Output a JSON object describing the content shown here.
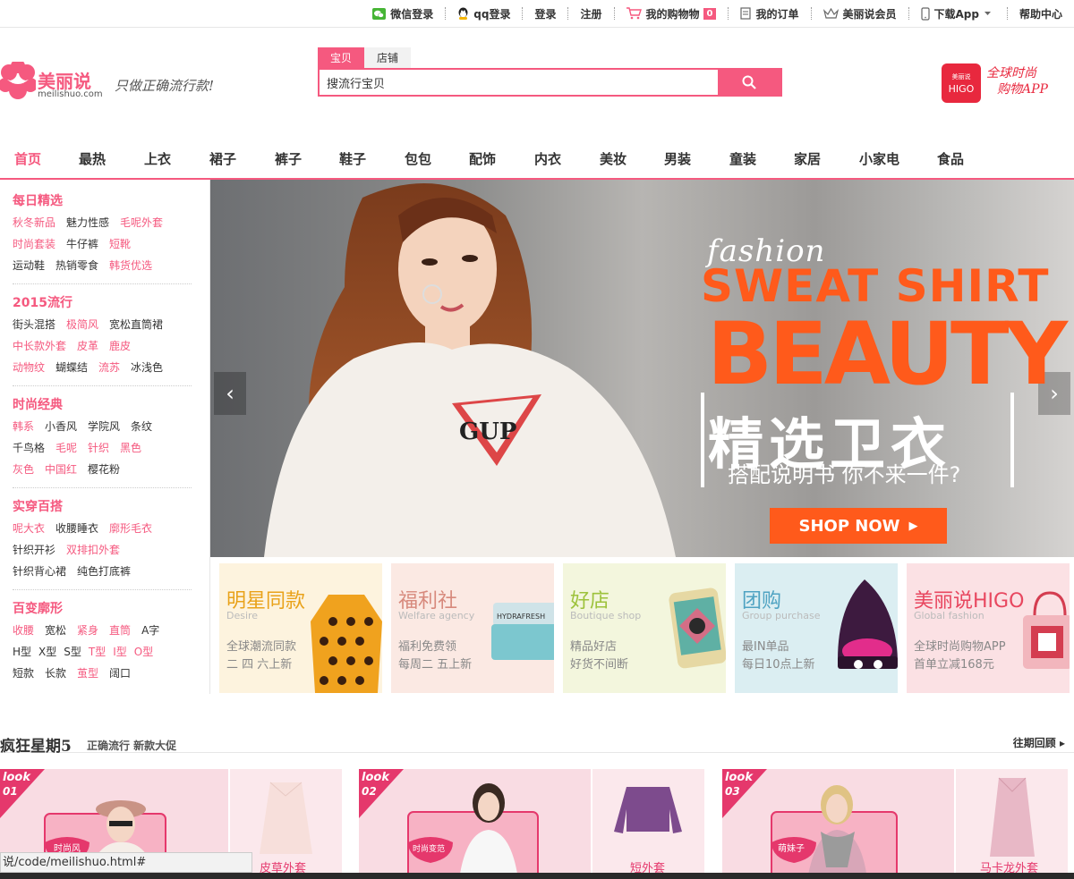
{
  "topbar": {
    "wechat_login": "微信登录",
    "qq_login": "qq登录",
    "login": "登录",
    "register": "注册",
    "cart_label": "我的购物物",
    "cart_count": "0",
    "orders": "我的订单",
    "vip": "美丽说会员",
    "download_app": "下载App",
    "help": "帮助中心"
  },
  "logo": {
    "name": "美丽说",
    "url": "meilishuo.com",
    "slogan": "只做正确流行款!"
  },
  "search": {
    "tabs": [
      "宝贝",
      "店铺"
    ],
    "value": "搜流行宝贝"
  },
  "higo": {
    "brand_top": "美丽说",
    "brand": "HIGO",
    "line1": "全球时尚",
    "line2": "购物APP"
  },
  "nav": [
    "首页",
    "最热",
    "上衣",
    "裙子",
    "裤子",
    "鞋子",
    "包包",
    "配饰",
    "内衣",
    "美妆",
    "男装",
    "童装",
    "家居",
    "小家电",
    "食品"
  ],
  "sidebar": {
    "groups": [
      {
        "title": "每日精选",
        "rows": [
          [
            "秋冬新品",
            "魅力性感",
            "毛呢外套"
          ],
          [
            "时尚套装",
            "牛仔裤",
            "短靴"
          ],
          [
            "运动鞋",
            "热销零食",
            "韩货优选"
          ]
        ]
      },
      {
        "title": "2015流行",
        "rows": [
          [
            "街头混搭",
            "极简风",
            "宽松直筒裙"
          ],
          [
            "中长款外套",
            "皮革",
            "鹿皮"
          ],
          [
            "动物纹",
            "蝴蝶结",
            "流苏",
            "冰浅色"
          ]
        ]
      },
      {
        "title": "时尚经典",
        "rows": [
          [
            "韩系",
            "小香风",
            "学院风",
            "条纹"
          ],
          [
            "千鸟格",
            "毛呢",
            "针织",
            "黑色"
          ],
          [
            "灰色",
            "中国红",
            "樱花粉"
          ]
        ]
      },
      {
        "title": "实穿百搭",
        "rows": [
          [
            "呢大衣",
            "收腰睡衣",
            "廓形毛衣"
          ],
          [
            "针织开衫",
            "双排扣外套"
          ],
          [
            "针织背心裙",
            "纯色打底裤"
          ]
        ]
      },
      {
        "title": "百变廓形",
        "rows": [
          [
            "收腰",
            "宽松",
            "紧身",
            "直筒",
            "A字"
          ],
          [
            "H型",
            "X型",
            "S型",
            "T型",
            "I型",
            "O型"
          ],
          [
            "短款",
            "长款",
            "茧型",
            "阔口"
          ]
        ]
      }
    ]
  },
  "banner": {
    "fashion": "fashion",
    "line1": "SWEAT SHIRT",
    "line2": "BEAUTY",
    "cn_title": "精选卫衣",
    "cn_sub": "搭配说明书 你不来一件?",
    "cta": "SHOP NOW",
    "shirt_logo": "GUP"
  },
  "cards": [
    {
      "title": "明星同款",
      "sub": "Desire",
      "l1": "全球潮流同款",
      "l2": "二 四 六上新",
      "color": "#e9a21a",
      "bg": "#fdf3de"
    },
    {
      "title": "福利社",
      "sub": "Welfare agency",
      "l1": "福利免费领",
      "l2": "每周二 五上新",
      "color": "#d7897c",
      "bg": "#fbe9e3"
    },
    {
      "title": "好店",
      "sub": "Boutique shop",
      "l1": "精品好店",
      "l2": "好货不间断",
      "color": "#9dc23c",
      "bg": "#f3f6dd"
    },
    {
      "title": "团购",
      "sub": "Group purchase",
      "l1": "最IN单品",
      "l2": "每日10点上新",
      "color": "#4fa3c2",
      "bg": "#dbeef2"
    },
    {
      "title": "美丽说HIGO",
      "sub": "Global fashion",
      "l1": "全球时尚购物APP",
      "l2": "首单立减168元",
      "color": "#e8475f",
      "bg": "#fbe1e4"
    }
  ],
  "cream": "HYDRAFRESH",
  "crazy": {
    "title": "疯狂星期5",
    "sub": "正确流行  新款大促",
    "more": "往期回顾 ▸"
  },
  "looks": [
    {
      "tag": "look",
      "num": "01",
      "bubble": "时尚风",
      "label": "皮草外套"
    },
    {
      "tag": "look",
      "num": "02",
      "bubble": "时尚变范",
      "label": "短外套"
    },
    {
      "tag": "look",
      "num": "03",
      "bubble": "萌妹子",
      "label": "马卡龙外套"
    }
  ],
  "status": "说/code/meilishuo.html#"
}
